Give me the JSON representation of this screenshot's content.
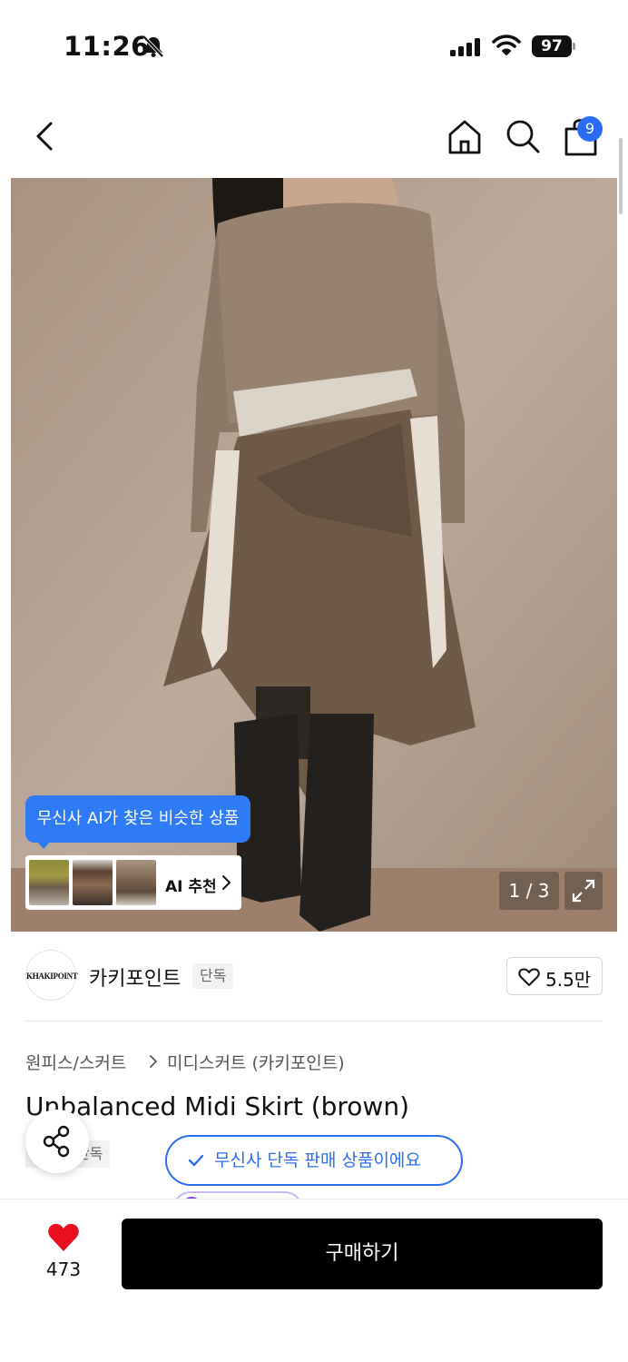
{
  "status_bar": {
    "time": "11:26",
    "battery": "97"
  },
  "header": {
    "cart_badge": "9",
    "icons": [
      "back-icon",
      "home-icon",
      "search-icon",
      "shopping-bag-icon"
    ]
  },
  "gallery": {
    "ai_tooltip": "무신사 AI가 찾은 비슷한 상품",
    "ai_reco_label": "AI 추천",
    "page_counter": "1 / 3"
  },
  "brand": {
    "logo_text": "KHAKIPOINT",
    "name": "카키포인트",
    "tag": "단독",
    "like_count": "5.5만"
  },
  "product": {
    "category": "원피스/스커트",
    "subcategory": "미디스커트 (카키포인트)",
    "title": "Unbalanced Midi Skirt (brown)",
    "exclusive_tag": "단독",
    "exclusive_notice": "무신사 단독 판매 상품이에요"
  },
  "bottom_bar": {
    "wish_count": "473",
    "buy_label": "구매하기"
  },
  "colors": {
    "accent_blue": "#2c6ef2",
    "heart_red": "#e8101f",
    "buy_button": "#000000"
  }
}
